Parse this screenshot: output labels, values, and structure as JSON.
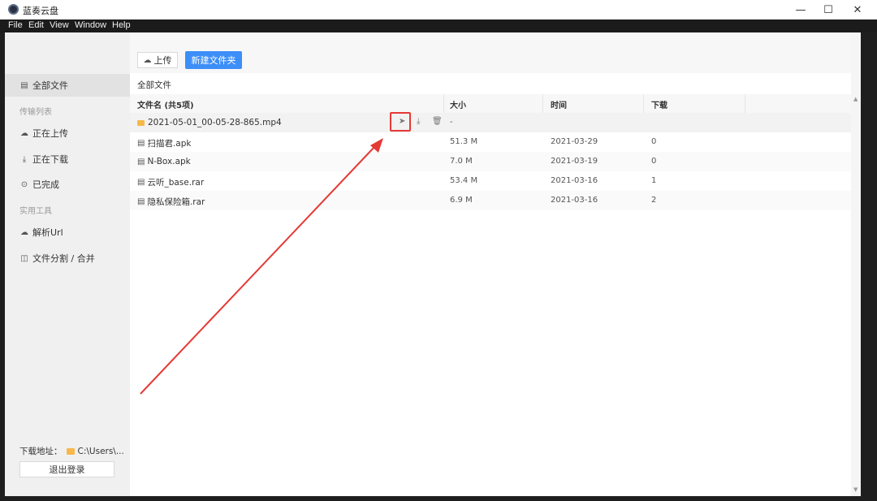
{
  "app": {
    "title": "蓝奏云盘"
  },
  "window_controls": {
    "minimize": "—",
    "maximize": "☐",
    "close": "✕"
  },
  "menu": [
    "File",
    "Edit",
    "View",
    "Window",
    "Help"
  ],
  "sidebar": {
    "all_files": "全部文件",
    "group_transfer": "传输列表",
    "uploading": "正在上传",
    "downloading": "正在下载",
    "completed": "已完成",
    "group_tools": "实用工具",
    "parse_url": "解析Url",
    "split_merge": "文件分割 / 合并",
    "download_path_label": "下载地址：",
    "download_path_value": "C:\\Users\\...",
    "logout": "退出登录"
  },
  "toolbar": {
    "upload": "上传",
    "new_folder": "新建文件夹"
  },
  "breadcrumb": "全部文件",
  "table": {
    "headers": {
      "name": "文件名 (共5项)",
      "size": "大小",
      "time": "时间",
      "downloads": "下载"
    },
    "rows": [
      {
        "name": "2021-05-01_00-05-28-865.mp4",
        "type": "folder",
        "size": "-",
        "time": "",
        "downloads": ""
      },
      {
        "name": "扫描君.apk",
        "type": "file",
        "size": "51.3 M",
        "time": "2021-03-29",
        "downloads": "0"
      },
      {
        "name": "N-Box.apk",
        "type": "file",
        "size": "7.0 M",
        "time": "2021-03-19",
        "downloads": "0"
      },
      {
        "name": "云听_base.rar",
        "type": "file",
        "size": "53.4 M",
        "time": "2021-03-16",
        "downloads": "1"
      },
      {
        "name": "隐私保险箱.rar",
        "type": "file",
        "size": "6.9 M",
        "time": "2021-03-16",
        "downloads": "2"
      }
    ]
  },
  "colors": {
    "primary": "#3d8ef7",
    "highlight": "#e53935",
    "folder": "#f7b84b"
  }
}
